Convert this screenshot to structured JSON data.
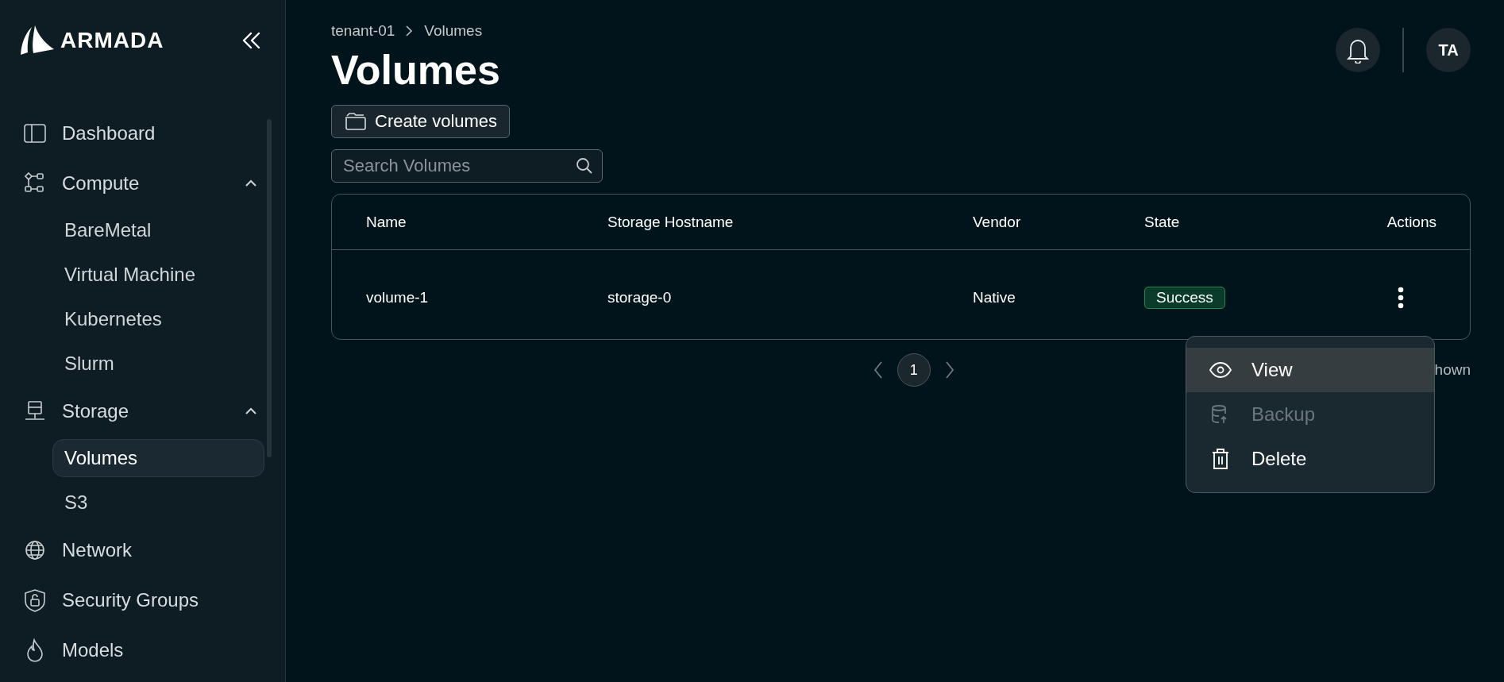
{
  "brand": {
    "name": "ARMADA"
  },
  "sidebar": {
    "items": [
      {
        "label": "Dashboard"
      },
      {
        "label": "Compute",
        "expanded": true,
        "children": [
          {
            "label": "BareMetal",
            "selected": false
          },
          {
            "label": "Virtual Machine",
            "selected": false
          },
          {
            "label": "Kubernetes",
            "selected": false
          },
          {
            "label": "Slurm",
            "selected": false
          }
        ]
      },
      {
        "label": "Storage",
        "expanded": true,
        "children": [
          {
            "label": "Volumes",
            "selected": true
          },
          {
            "label": "S3",
            "selected": false
          }
        ]
      },
      {
        "label": "Network"
      },
      {
        "label": "Security Groups"
      },
      {
        "label": "Models"
      }
    ]
  },
  "breadcrumb": [
    "tenant-01",
    "Volumes"
  ],
  "page_title": "Volumes",
  "create_button": "Create volumes",
  "search": {
    "placeholder": "Search Volumes"
  },
  "avatar": "TA",
  "table": {
    "columns": [
      "Name",
      "Storage Hostname",
      "Vendor",
      "State",
      "Actions"
    ],
    "rows": [
      {
        "name": "volume-1",
        "storage_hostname": "storage-0",
        "vendor": "Native",
        "state": "Success",
        "color": "#1f8a4c"
      }
    ]
  },
  "pagination": {
    "pages": [
      {
        "label": "1",
        "selected": true
      }
    ]
  },
  "footer_text": "hown",
  "action_menu": {
    "items": [
      {
        "label": "View",
        "highlighted": true,
        "disabled": false
      },
      {
        "label": "Backup",
        "highlighted": false,
        "disabled": true
      },
      {
        "label": "Delete",
        "highlighted": false,
        "disabled": false
      }
    ]
  }
}
